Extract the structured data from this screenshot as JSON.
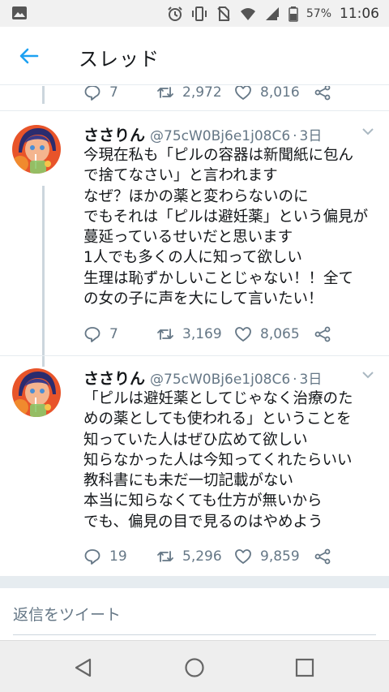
{
  "status_bar": {
    "battery_percent": "57%",
    "time": "11:06",
    "icons": [
      "gallery-icon",
      "alarm-icon",
      "vibrate-icon",
      "no-sim-icon",
      "wifi-icon",
      "signal-icon",
      "battery-icon"
    ]
  },
  "header": {
    "title": "スレッド",
    "accent_color": "#1da1f2"
  },
  "previous_tweet": {
    "replies": "7",
    "retweets": "2,972",
    "likes": "8,016"
  },
  "tweets": [
    {
      "name": "ささりん",
      "handle": "@75cW0Bj6e1j08C6",
      "dot": "·",
      "time": "3日",
      "lines": [
        "今現在私も「ピルの容器は新聞紙に包ん",
        "で捨てなさい」と言われます",
        "なぜ？ほかの薬と変わらないのに",
        "でもそれは「ピルは避妊薬」という偏見が",
        "蔓延っているせいだと思います",
        "1人でも多くの人に知って欲しい",
        "生理は恥ずかしいことじゃない！！全て",
        "の女の子に声を大にして言いたい！"
      ],
      "replies": "7",
      "retweets": "3,169",
      "likes": "8,065"
    },
    {
      "name": "ささりん",
      "handle": "@75cW0Bj6e1j08C6",
      "dot": "·",
      "time": "3日",
      "lines": [
        "「ピルは避妊薬としてじゃなく治療のた",
        "めの薬としても使われる」ということを",
        "知っていた人はぜひ広めて欲しい",
        "知らなかった人は今知ってくれたらいい",
        "教科書にも未だ一切記載がない",
        "本当に知らなくても仕方が無いから",
        "でも、偏見の目で見るのはやめよう"
      ],
      "replies": "19",
      "retweets": "5,296",
      "likes": "9,859"
    }
  ],
  "reply_bar": {
    "placeholder": "返信をツイート"
  },
  "nav": {
    "icons": [
      "back-triangle-icon",
      "home-circle-icon",
      "recents-square-icon"
    ]
  }
}
